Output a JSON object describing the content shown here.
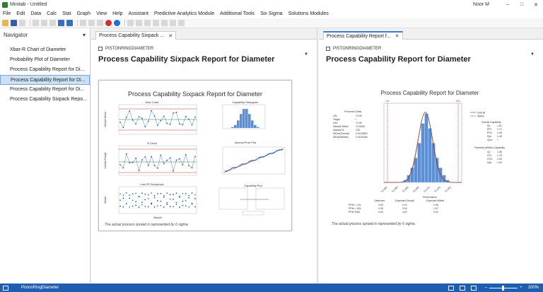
{
  "window": {
    "title": "Minitab - Untitled",
    "user": "Noor M",
    "minimize": "–",
    "maximize": "□",
    "close": "✕"
  },
  "menu": [
    "File",
    "Edit",
    "Data",
    "Calc",
    "Stat",
    "Graph",
    "View",
    "Help",
    "Assistant",
    "Predictive Analytics Module",
    "Additional Tools",
    "Six Sigma",
    "Solutions Modules"
  ],
  "navigator": {
    "title": "Navigator",
    "collapse": "▾",
    "items": [
      {
        "label": "Xbar-R Chart of Diameter"
      },
      {
        "label": "Probability Plot of Diameter"
      },
      {
        "label": "Process Capability Report for Di..."
      },
      {
        "label": "Process Capability Report for Di..."
      },
      {
        "label": "Process Capability Report for Di..."
      },
      {
        "label": "Process Capability Sixpack Repo..."
      }
    ]
  },
  "left_pane": {
    "tab": "Process Capability Sixpack ...",
    "tab_close": "✕",
    "worksheet": "PISTONRINGDIAMETER",
    "title": "Process Capability Sixpack Report for Diameter",
    "dropdown": "▼",
    "graph": {
      "title": "Process Capability Sixpack Report for Diameter",
      "xbar_title": "Xbar Chart",
      "hist_title": "Capability Histogram",
      "rchart_title": "R Chart",
      "normprob_title": "Normal Prob Plot",
      "last_title": "Last 25 Subgroups",
      "capplot_title": "Capability Plot",
      "xbar_ylabel": "Sample Mean",
      "r_ylabel": "Sample Range",
      "last_ylabel": "Values",
      "last_xlabel": "Sample",
      "caption": "The actual process spread is represented by 6 sigma."
    }
  },
  "right_pane": {
    "tab": "Process Capability Report f...",
    "tab_close": "✕",
    "worksheet": "PISTONRINGDIAMETER",
    "title": "Process Capability Report for Diameter",
    "dropdown": "▼",
    "graph": {
      "title": "Process Capability Report for Diameter",
      "process_data_title": "Process Data",
      "process_data": [
        {
          "label": "LSL",
          "value": "73.95"
        },
        {
          "label": "Target",
          "value": "*"
        },
        {
          "label": "USL",
          "value": "74.05"
        },
        {
          "label": "Sample Mean",
          "value": "74.0036"
        },
        {
          "label": "Sample N",
          "value": "125"
        },
        {
          "label": "StDev(Overall)",
          "value": "0.0103809"
        },
        {
          "label": "StDev(Within)",
          "value": "0.0100338"
        }
      ],
      "legend": [
        {
          "label": "Overall"
        },
        {
          "label": "Within"
        }
      ],
      "overall_title": "Overall Capability",
      "overall": [
        {
          "label": "Pp",
          "value": "1.61"
        },
        {
          "label": "PPL",
          "value": "1.72"
        },
        {
          "label": "PPU",
          "value": "1.49"
        },
        {
          "label": "Ppk",
          "value": "1.49"
        },
        {
          "label": "Cpm",
          "value": "*"
        }
      ],
      "within_title": "Potential (Within) Capability",
      "within": [
        {
          "label": "Cp",
          "value": "1.66"
        },
        {
          "label": "CPL",
          "value": "1.78"
        },
        {
          "label": "CPU",
          "value": "1.54"
        },
        {
          "label": "Cpk",
          "value": "1.54"
        }
      ],
      "lsl_label": "LSL",
      "usl_label": "USL",
      "x_ticks": [
        "73.950",
        "73.965",
        "73.980",
        "73.995",
        "74.010",
        "74.025",
        "74.040"
      ],
      "perf_title": "Performance",
      "perf_headers": [
        "Observed",
        "Expected Overall",
        "Expected Within"
      ],
      "perf_rows": [
        {
          "label": "PPM < LSL",
          "values": [
            "0.00",
            "0.12",
            "0.05"
          ]
        },
        {
          "label": "PPM > USL",
          "values": [
            "0.00",
            "3.90",
            "1.97"
          ]
        },
        {
          "label": "PPM Total",
          "values": [
            "0.00",
            "4.02",
            "2.02"
          ]
        }
      ],
      "caption": "The actual process spread is represented by 6 sigma."
    }
  },
  "chart_data": {
    "type": "bar",
    "title": "Process Capability Report for Diameter",
    "xlabel": "",
    "ylabel": "",
    "categories": [
      "73.975",
      "73.980",
      "73.985",
      "73.990",
      "73.995",
      "74.000",
      "74.005",
      "74.010",
      "74.015",
      "74.020",
      "74.025",
      "74.030",
      "74.035"
    ],
    "values": [
      1,
      3,
      6,
      10,
      16,
      24,
      28,
      22,
      16,
      10,
      6,
      3,
      1
    ],
    "xlim": [
      73.945,
      74.055
    ],
    "lsl": 73.95,
    "usl": 74.05,
    "mean": 74.0036,
    "colors": {
      "bars": "#5b8fd6",
      "overall": "#c0392b",
      "within": "#444444",
      "spec": "#c0392b"
    }
  },
  "status": {
    "worksheet": "PistonRingDiameter",
    "zoom": "100%",
    "zoom_out": "–",
    "zoom_in": "+"
  }
}
